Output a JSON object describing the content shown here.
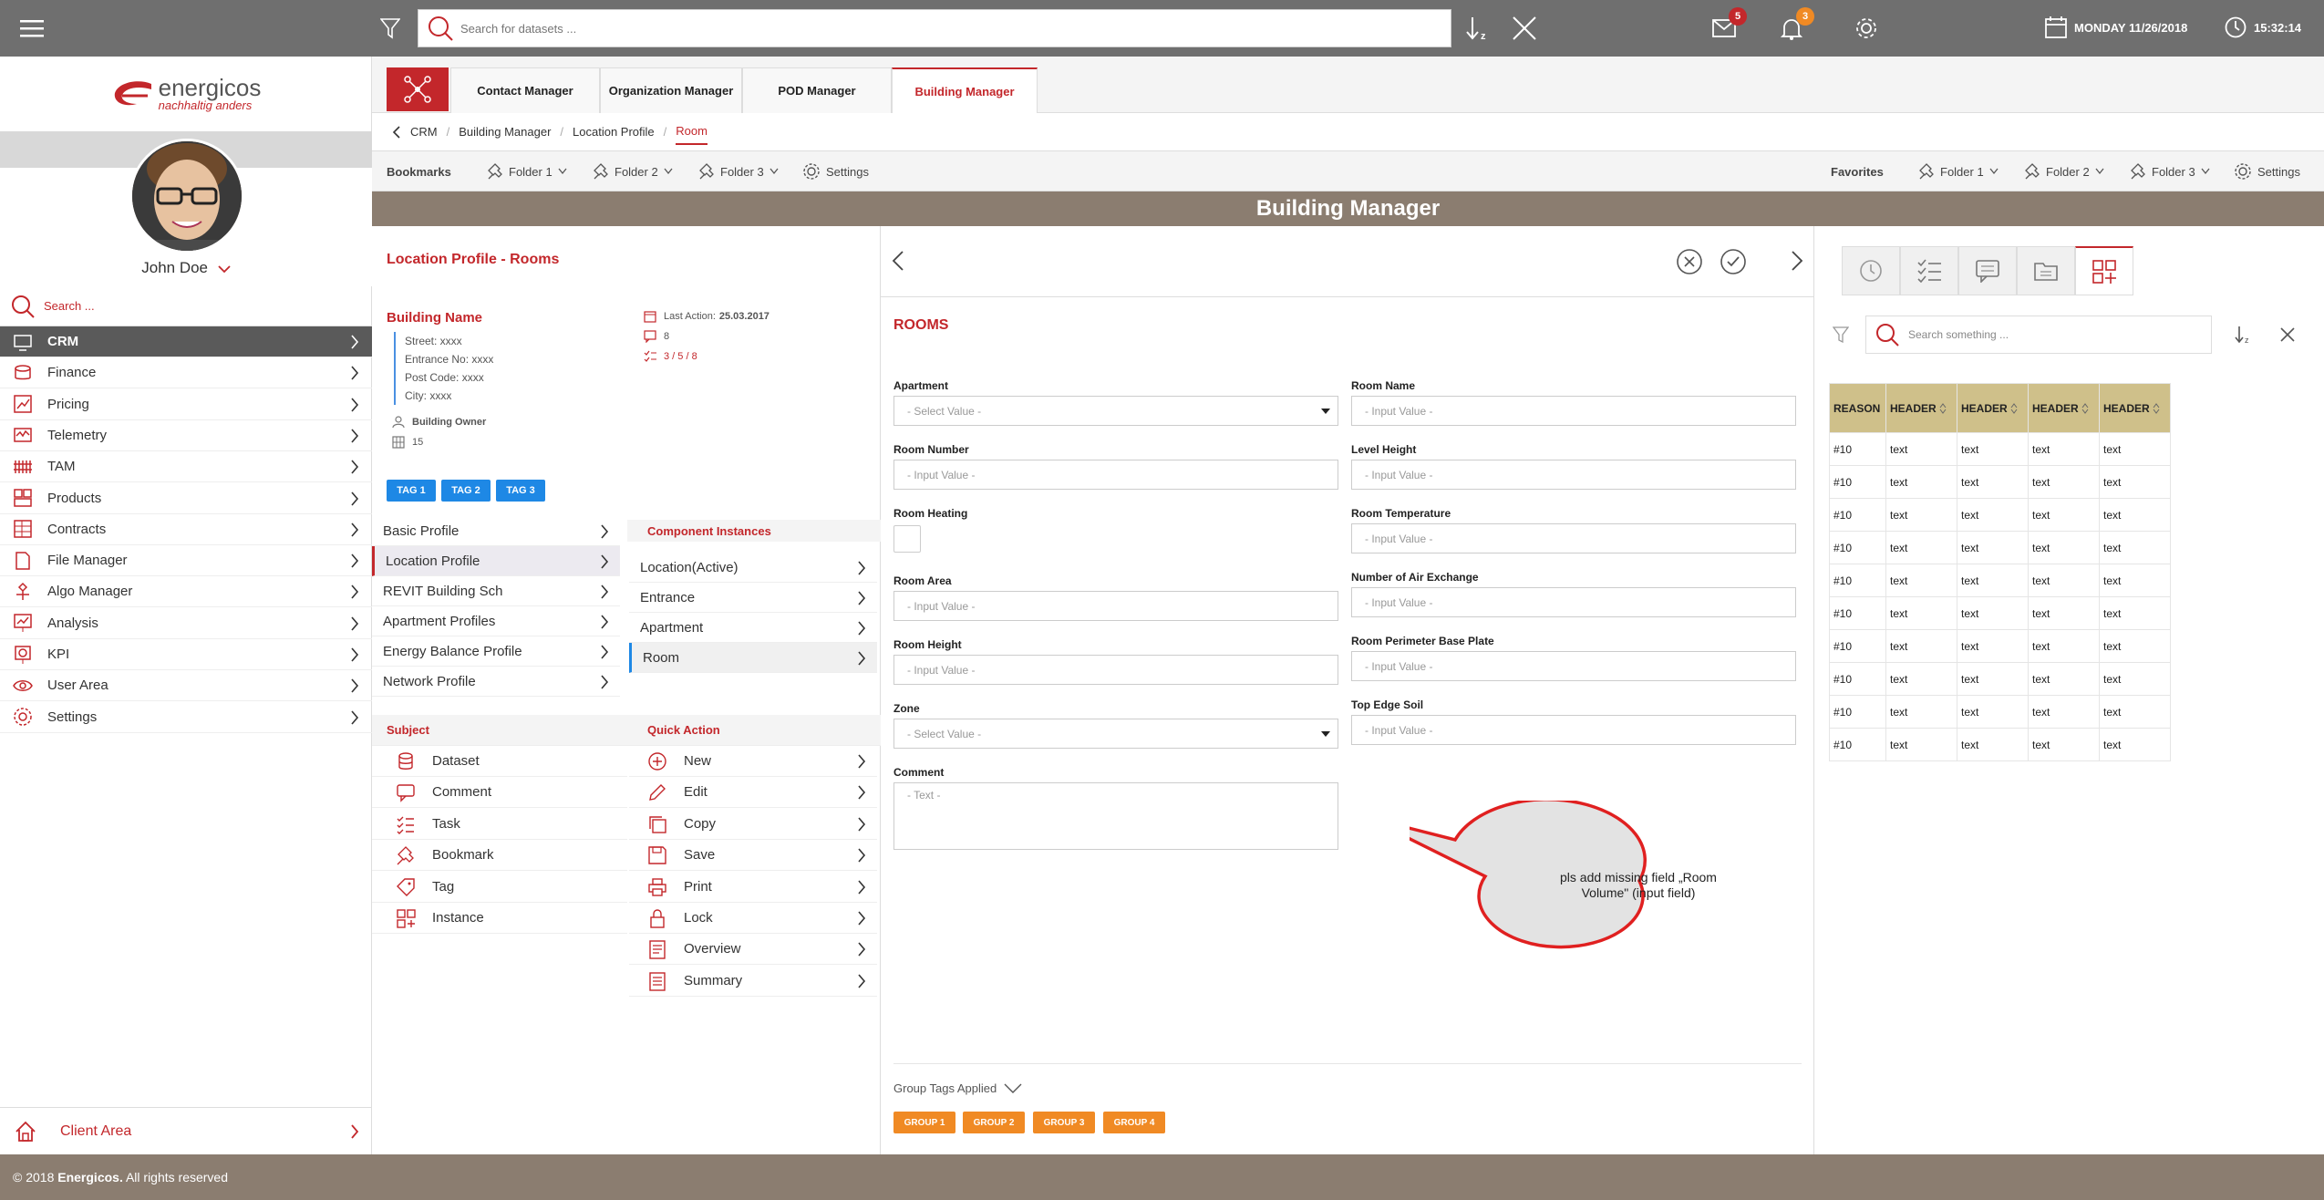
{
  "topbar": {
    "search_placeholder": "Search for datasets ...",
    "mail_count": "5",
    "notification_count": "3",
    "date": "MONDAY 11/26/2018",
    "time": "15:32:14",
    "sort_label": "z"
  },
  "sidebar": {
    "brand": "energicos",
    "slogan": "nachhaltig anders",
    "user_name": "John Doe",
    "search_placeholder": "Search ...",
    "items": [
      {
        "label": "CRM",
        "icon": "crm-icon"
      },
      {
        "label": "Finance",
        "icon": "coins-icon"
      },
      {
        "label": "Pricing",
        "icon": "pricing-icon"
      },
      {
        "label": "Telemetry",
        "icon": "telemetry-icon"
      },
      {
        "label": "TAM",
        "icon": "radiator-icon"
      },
      {
        "label": "Products",
        "icon": "products-icon"
      },
      {
        "label": "Contracts",
        "icon": "contracts-icon"
      },
      {
        "label": "File Manager",
        "icon": "file-icon"
      },
      {
        "label": "Algo Manager",
        "icon": "algo-icon"
      },
      {
        "label": "Analysis",
        "icon": "analysis-icon"
      },
      {
        "label": "KPI",
        "icon": "kpi-icon"
      },
      {
        "label": "User Area",
        "icon": "eye-icon"
      },
      {
        "label": "Settings",
        "icon": "gear-icon"
      }
    ],
    "client_area": "Client Area"
  },
  "footer": {
    "copyright_prefix": "© 2018 ",
    "company": "Energicos.",
    "rights": " All rights reserved"
  },
  "tabs": [
    {
      "label": "Contact Manager"
    },
    {
      "label": "Organization Manager"
    },
    {
      "label": "POD Manager"
    },
    {
      "label": "Building Manager",
      "active": true
    }
  ],
  "breadcrumb": [
    "CRM",
    "Building Manager",
    "Location Profile",
    "Room"
  ],
  "bookmarks": {
    "label": "Bookmarks",
    "folders": [
      "Folder 1",
      "Folder 2",
      "Folder 3"
    ],
    "settings": "Settings",
    "favorites_label": "Favorites",
    "favorites": [
      "Folder 1",
      "Folder 2",
      "Folder 3"
    ],
    "favorites_settings": "Settings"
  },
  "page_title": "Building Manager",
  "left_panel": {
    "title": "Location Profile - Rooms",
    "building_name": "Building Name",
    "street": "Street: xxxx",
    "entrance": "Entrance No: xxxx",
    "postcode": "Post Code: xxxx",
    "city": "City: xxxx",
    "owner_label": "Building Owner",
    "owner_value": "15",
    "last_action_label": "Last Action:",
    "last_action_date": "25.03.2017",
    "comments_count": "8",
    "tasks": "3 / 5 / 8",
    "tags": [
      "TAG 1",
      "TAG 2",
      "TAG 3"
    ],
    "profiles": [
      "Basic Profile",
      "Location Profile",
      "REVIT Building Sch",
      "Apartment Profiles",
      "Energy Balance Profile",
      "Network Profile"
    ],
    "component_header": "Component Instances",
    "components": [
      "Location(Active)",
      "Entrance",
      "Apartment",
      "Room"
    ],
    "subject_header": "Subject",
    "subjects": [
      {
        "label": "Dataset",
        "icon": "database-icon"
      },
      {
        "label": "Comment",
        "icon": "comment-icon"
      },
      {
        "label": "Task",
        "icon": "task-icon"
      },
      {
        "label": "Bookmark",
        "icon": "bookmark-icon"
      },
      {
        "label": "Tag",
        "icon": "tag-icon"
      },
      {
        "label": "Instance",
        "icon": "instance-icon"
      }
    ],
    "quick_header": "Quick Action",
    "quick_actions": [
      {
        "label": "New",
        "icon": "plus-circle-icon"
      },
      {
        "label": "Edit",
        "icon": "pencil-icon"
      },
      {
        "label": "Copy",
        "icon": "copy-icon"
      },
      {
        "label": "Save",
        "icon": "save-icon"
      },
      {
        "label": "Print",
        "icon": "print-icon"
      },
      {
        "label": "Lock",
        "icon": "lock-icon"
      },
      {
        "label": "Overview",
        "icon": "overview-icon"
      },
      {
        "label": "Summary",
        "icon": "summary-icon"
      }
    ]
  },
  "form": {
    "title": "ROOMS",
    "apartment_label": "Apartment",
    "apartment_value": "- Select Value -",
    "room_number_label": "Room Number",
    "room_number_value": "- Input Value -",
    "room_heating_label": "Room Heating",
    "room_area_label": "Room Area",
    "room_area_value": "- Input Value -",
    "room_height_label": "Room Height",
    "room_height_value": "- Input Value -",
    "zone_label": "Zone",
    "zone_value": "- Select Value -",
    "comment_label": "Comment",
    "comment_value": "- Text -",
    "room_name_label": "Room Name",
    "room_name_value": "- Input Value -",
    "level_height_label": "Level Height",
    "level_height_value": "- Input Value -",
    "room_temp_label": "Room Temperature",
    "room_temp_value": "- Input Value -",
    "air_exchange_label": "Number of Air Exchange",
    "air_exchange_value": "- Input Value -",
    "perimeter_label": "Room Perimeter Base Plate",
    "perimeter_value": "- Input Value -",
    "top_edge_label": "Top Edge Soil",
    "top_edge_value": "- Input Value -",
    "group_tags_label": "Group Tags Applied",
    "group_tags": [
      "GROUP 1",
      "GROUP 2",
      "GROUP 3",
      "GROUP 4"
    ],
    "callout": "pls add missing field „Room Volume\" (input field)"
  },
  "right_panel": {
    "search_placeholder": "Search something ...",
    "headers": [
      "REASON",
      "HEADER",
      "HEADER",
      "HEADER",
      "HEADER"
    ],
    "rows": [
      [
        "#10",
        "text",
        "text",
        "text",
        "text"
      ],
      [
        "#10",
        "text",
        "text",
        "text",
        "text"
      ],
      [
        "#10",
        "text",
        "text",
        "text",
        "text"
      ],
      [
        "#10",
        "text",
        "text",
        "text",
        "text"
      ],
      [
        "#10",
        "text",
        "text",
        "text",
        "text"
      ],
      [
        "#10",
        "text",
        "text",
        "text",
        "text"
      ],
      [
        "#10",
        "text",
        "text",
        "text",
        "text"
      ],
      [
        "#10",
        "text",
        "text",
        "text",
        "text"
      ],
      [
        "#10",
        "text",
        "text",
        "text",
        "text"
      ],
      [
        "#10",
        "text",
        "text",
        "text",
        "text"
      ]
    ]
  },
  "colors": {
    "accent": "#c3272b",
    "tag_blue": "#1e88e5",
    "group_orange": "#f08a24",
    "topbar": "#6f6f6f",
    "brown": "#8b7d70",
    "table_header": "#cfc08a"
  }
}
